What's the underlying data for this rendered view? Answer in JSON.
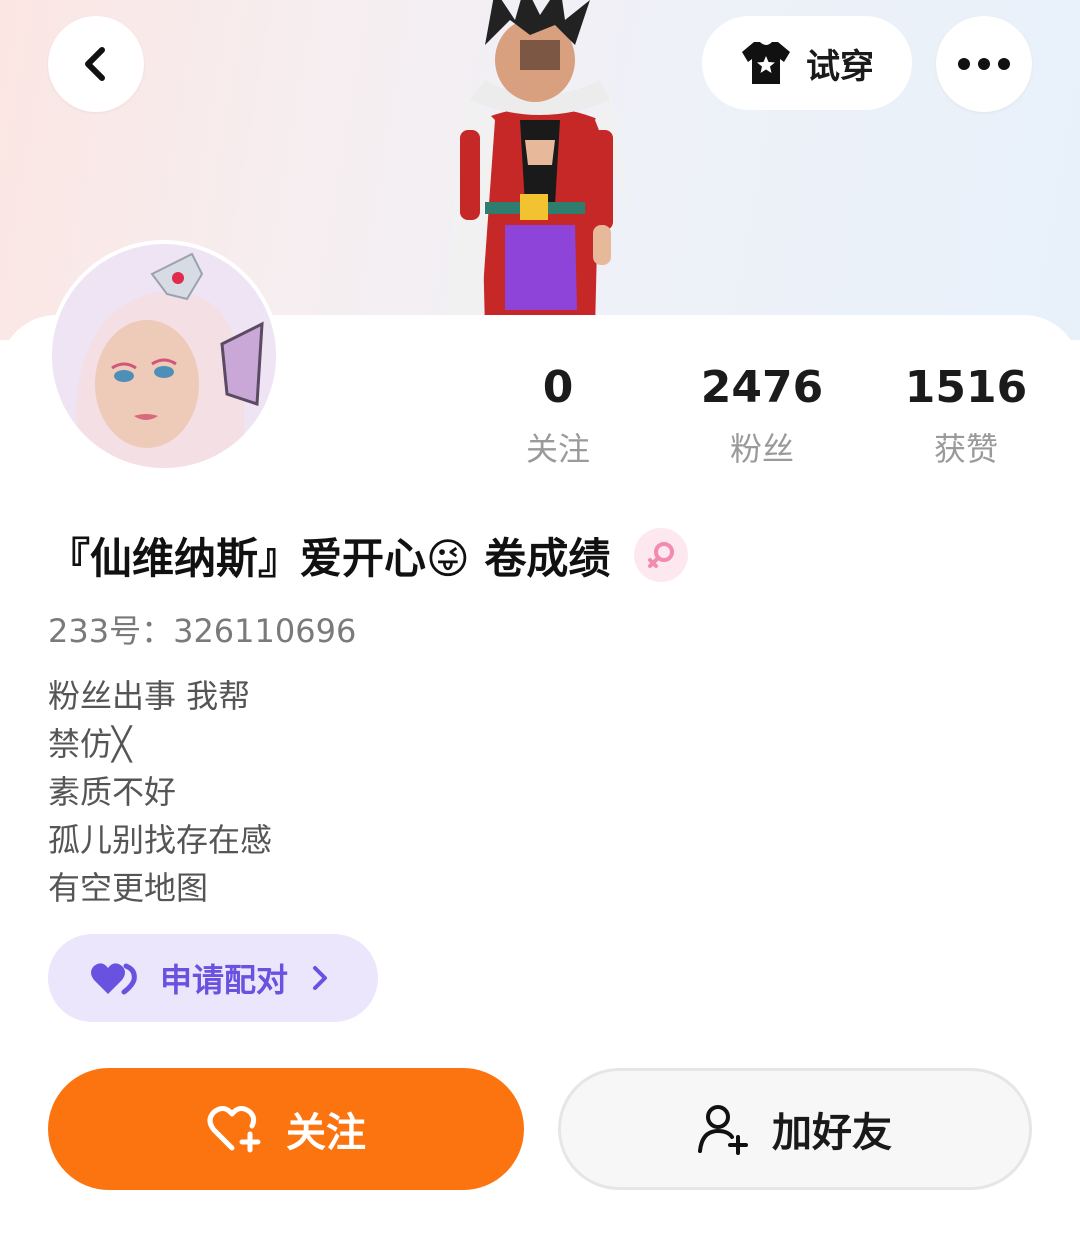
{
  "header": {
    "back_icon": "chevron-left-icon",
    "try_on_label": "试穿",
    "try_on_icon": "tshirt-star-icon",
    "more_icon": "more-dots-icon"
  },
  "profile": {
    "name": "『仙维纳斯』爱开心😜 卷成绩",
    "gender_icon": "female-icon",
    "uid": "233号：326110696",
    "bio_lines": [
      "粉丝出事 我帮",
      "禁仿╳",
      "素质不好",
      "孤儿别找存在感",
      "有空更地图"
    ]
  },
  "stats": [
    {
      "value": "0",
      "label": "关注"
    },
    {
      "value": "2476",
      "label": "粉丝"
    },
    {
      "value": "1516",
      "label": "获赞"
    }
  ],
  "pair_button": {
    "label": "申请配对",
    "icon": "heart-pair-icon"
  },
  "actions": {
    "follow_label": "关注",
    "add_friend_label": "加好友"
  },
  "colors": {
    "accent_orange": "#fc7410",
    "pair_purple": "#6a52e0",
    "pair_bg": "#ebe6fb"
  }
}
